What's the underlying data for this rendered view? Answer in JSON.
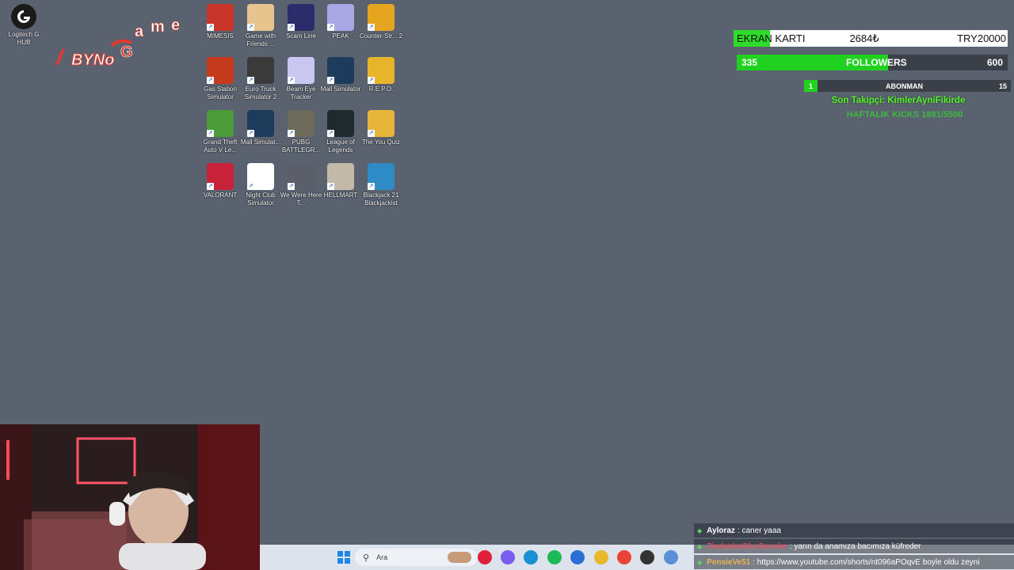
{
  "desktop": {
    "left_icon": {
      "label": "Logitech G HUB",
      "icon": "logitech-g-icon"
    },
    "icons": [
      {
        "label": "MIMESIS",
        "icon": "rooster-icon",
        "color": "#c9352b"
      },
      {
        "label": "Game with Friends ...",
        "icon": "game-with-friends-icon",
        "color": "#e7c38d"
      },
      {
        "label": "Scam Line",
        "icon": "scam-line-icon",
        "color": "#2b2d6a"
      },
      {
        "label": "PEAK",
        "icon": "mountain-icon",
        "color": "#a9a7e6"
      },
      {
        "label": "Counter-Str... 2",
        "icon": "counter-strike-icon",
        "color": "#e6a51f"
      },
      {
        "label": "Gas Station Simulator",
        "icon": "gas-station-icon",
        "color": "#c63a1e"
      },
      {
        "label": "Euro Truck Simulator 2",
        "icon": "truck-icon",
        "color": "#3a3a3a"
      },
      {
        "label": "Beam Eye Tracker",
        "icon": "beam-eye-icon",
        "color": "#c9c6f2"
      },
      {
        "label": "Mall Simulator",
        "icon": "mall-simulator-icon",
        "color": "#1d3c5c"
      },
      {
        "label": "R.E.P.O.",
        "icon": "repo-icon",
        "color": "#e6b52a"
      },
      {
        "label": "Grand Theft Auto V Le...",
        "icon": "gta-v-icon",
        "color": "#4b9b3a"
      },
      {
        "label": "Mall Simulat...",
        "icon": "mall-simulator-icon",
        "color": "#1d3c5c"
      },
      {
        "label": "PUBG BATTLEGR...",
        "icon": "pubg-helmet-icon",
        "color": "#6d6a5a"
      },
      {
        "label": "League of Legends",
        "icon": "league-of-legends-icon",
        "color": "#1e2a2e"
      },
      {
        "label": "The You Quiz",
        "icon": "you-quiz-icon",
        "color": "#e7b53a"
      },
      {
        "label": "VALORANT",
        "icon": "valorant-icon",
        "color": "#c8223a"
      },
      {
        "label": "Night Club Simulator",
        "icon": "cocktail-icon",
        "color": "#ffffff"
      },
      {
        "label": "We Were Here T...",
        "icon": "walkie-talkie-icon",
        "color": "#5b5f6a"
      },
      {
        "label": "HELLMART",
        "icon": "hellmart-icon",
        "color": "#c3b9a8"
      },
      {
        "label": "Blackjack 21 Blackjackist",
        "icon": "blackjack-icon",
        "color": "#2f8bc6"
      }
    ]
  },
  "logo": {
    "line1": "BYNO",
    "line2": "Game"
  },
  "overlay": {
    "ekran": {
      "label": "EKRAN KARTI",
      "current": "2684₺",
      "target": "TRY20000",
      "fraction": 0.134
    },
    "followers": {
      "current": "335",
      "label": "FOLLOWERS",
      "target": "600",
      "fraction": 0.558
    },
    "abonman": {
      "current": "1",
      "label": "ABONMAN",
      "target": "15",
      "fraction": 0.067
    },
    "last_follower": "Son Takipçi: KimlerAyniFikirde",
    "weekly": "HAFTALIK KICKS 1881/5500"
  },
  "chat": [
    {
      "user": "Ayloraz",
      "message": ": caner yaaa",
      "color": "#ffffff"
    },
    {
      "user": "ZindanImOlurGeceler",
      "message": ": yarın da anamıza bacımıza küfreder",
      "color": "#e0505f"
    },
    {
      "user": "PensieVe51",
      "message": ": https://www.youtube.com/shorts/nt096aPOqvE boyle oldu zeyni",
      "color": "#e8b455"
    }
  ],
  "taskbar": {
    "search_placeholder": "Ara",
    "apps": [
      "windows-start-icon",
      "opera-gx-icon",
      "copilot-icon",
      "edge-icon",
      "spotify-icon",
      "store-icon",
      "file-explorer-icon",
      "chrome-icon",
      "obs-icon",
      "settings-icon"
    ]
  },
  "colors": {
    "desktop_bg": "#5a6270",
    "accent_green": "#20d21f"
  }
}
